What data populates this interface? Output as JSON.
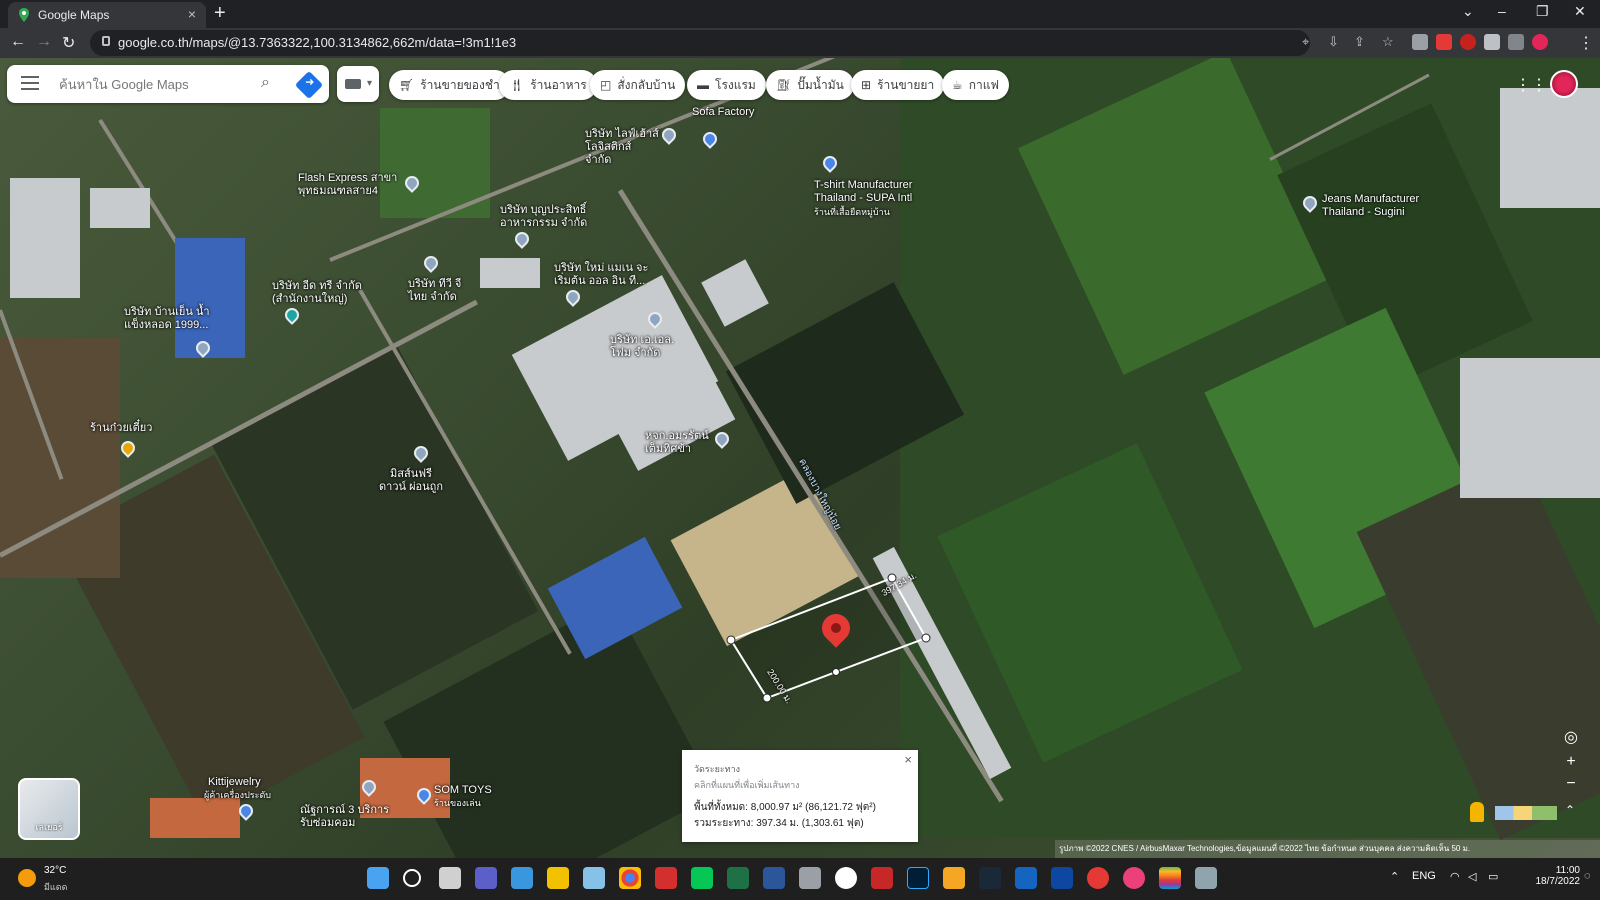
{
  "browser": {
    "tab_title": "Google Maps",
    "new_tab": "+",
    "url": "google.co.th/maps/@13.7363322,100.3134862,662m/data=!3m1!1e3"
  },
  "maps": {
    "search_placeholder": "ค้นหาใน Google Maps",
    "chips": [
      {
        "icon": "shopping-cart-icon",
        "label": "ร้านขายของชำ"
      },
      {
        "icon": "restaurant-icon",
        "label": "ร้านอาหาร"
      },
      {
        "icon": "takeout-icon",
        "label": "สั่งกลับบ้าน"
      },
      {
        "icon": "hotel-icon",
        "label": "โรงแรม"
      },
      {
        "icon": "gas-station-icon",
        "label": "ปั๊มน้ำมัน"
      },
      {
        "icon": "pharmacy-icon",
        "label": "ร้านขายยา"
      },
      {
        "icon": "coffee-icon",
        "label": "กาแฟ"
      }
    ],
    "places": [
      "Sofa Factory",
      "บริษัท ไลฟ์เฮ้าส์ โลจิสติกส์ จำกัด",
      "Flash Express สาขา พุทธมณฑลสาย4",
      "T-shirt Manufacturer Thailand - SUPA Intl",
      "ร้านที่เสื้อยืดหมู่บ้าน",
      "Jeans Manufacturer Thailand - Sugini",
      "บริษัท บุญประสิทธิ์ อาหารกรรม จำกัด",
      "บริษัท ใหม่ แมเน จะเริ่มต้น ออล อิน ที...",
      "บริษัท ทีวี จี ไทย จำกัด",
      "บริษัท อีด ทรี จำกัด (สำนักงานใหญ่)",
      "บริษัท บ้านเย็น น้ำแข็งหลอด 1999...",
      "บริษัท เอ.เอล. โฟม จำกัด",
      "หจก.อมรรัตน์ เต็มทิศข้า",
      "ร้านก๋วยเตี๋ยว",
      "มิสส์นฟรี ดาวน์ ผ่อนถูก",
      "Kittijewelry",
      "ผู้ค้าเครื่องประดับ",
      "SOM TOYS",
      "ร้านของเล่น",
      "ณัฐการณ์ 3 บริการรับซ่อมคอม",
      "คลองบางใหญ่น้อย"
    ],
    "measure": {
      "edge_label_1": "397.34 ม.",
      "edge_label_2": "200.00 ม.",
      "popup_title": "วัดระยะทาง",
      "popup_hint": "คลิกที่แผนที่เพื่อเพิ่มเส้นทาง",
      "area": "พื้นที่ทั้งหมด: 8,000.97 ม² (86,121.72 ฟุต²)",
      "distance": "รวมระยะทาง: 397.34 ม. (1,303.61 ฟุต)",
      "close": "×"
    },
    "layers_label": "เลเยอร์",
    "zoom_in": "+",
    "zoom_out": "−",
    "attribution": "รูปภาพ ©2022 CNES / AirbusMaxar Technologies,ข้อมูลแผนที่ ©2022   ไทย   ข้อกำหนด   ส่วนบุคคล   ส่งความคิดเห็น   50 ม."
  },
  "taskbar": {
    "temperature": "32°C",
    "condition": "มีแดด",
    "lang": "ENG",
    "time": "11:00",
    "date": "18/7/2022"
  },
  "colors": {
    "accent": "#1a73e8",
    "pin_red": "#e53935",
    "chrome_dark": "#202124"
  }
}
